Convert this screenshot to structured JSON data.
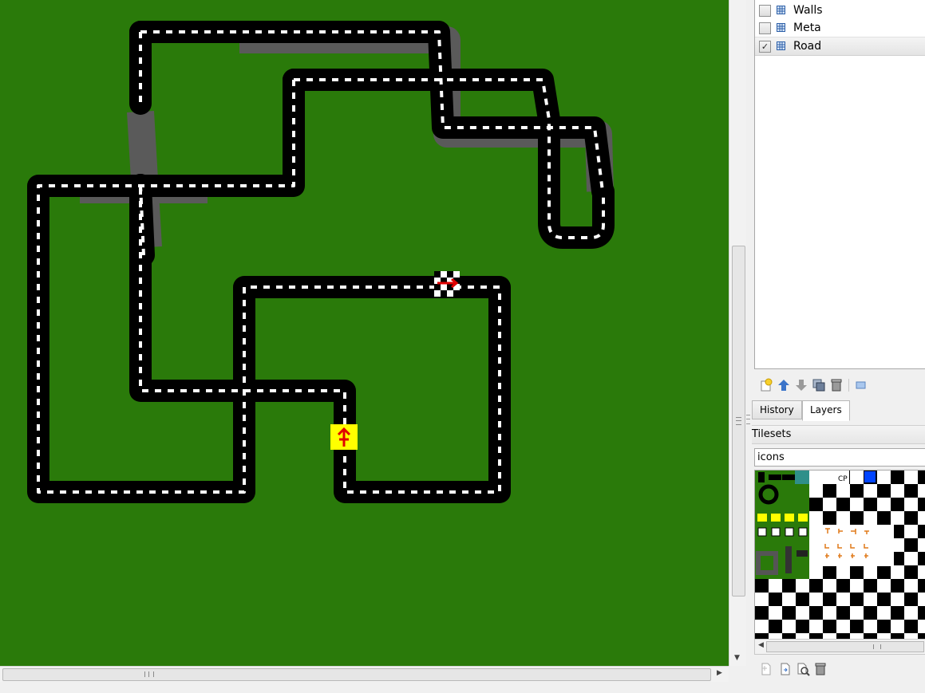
{
  "layers": {
    "items": [
      {
        "name": "Walls",
        "checked": false
      },
      {
        "name": "Meta",
        "checked": false
      },
      {
        "name": "Road",
        "checked": true
      }
    ]
  },
  "layer_toolbar": {
    "icons": [
      "new-layer-icon",
      "move-layer-up-icon",
      "move-layer-down-icon",
      "duplicate-layer-icon",
      "delete-layer-icon",
      "layer-properties-icon"
    ]
  },
  "tabs": {
    "history": "History",
    "layers": "Layers",
    "active": "layers"
  },
  "tilesets": {
    "header": "Tilesets",
    "selected": "icons",
    "cp_label": "CP"
  },
  "tileset_toolbar": {
    "icons": [
      "new-tileset-icon",
      "import-tileset-icon",
      "edit-tileset-icon",
      "remove-tileset-icon"
    ]
  },
  "colors": {
    "grass": "#2a7a0a",
    "road": "#000000",
    "road_line": "#ffffff",
    "wall": "#555555",
    "checkpoint": "#ffff00",
    "arrow": "#e00000"
  }
}
